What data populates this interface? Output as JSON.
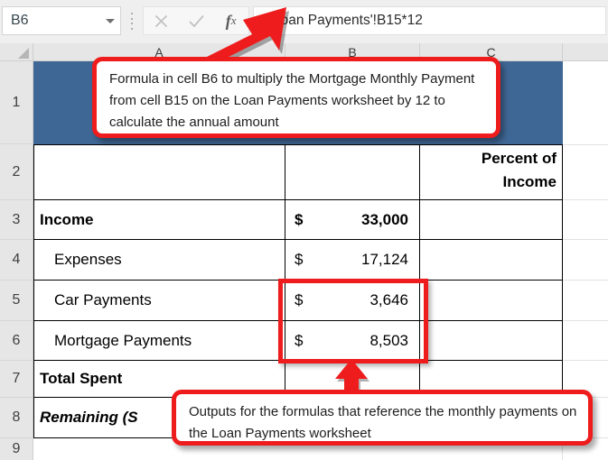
{
  "app": {
    "name": "Microsoft Excel",
    "colors": {
      "accent_red": "#ee1c1c",
      "row1_fill_blue": "#3f6795",
      "header_gray": "#e6e6e6",
      "toolbar_gray": "#efeff0"
    }
  },
  "formula_bar": {
    "name_box_value": "B6",
    "name_box_dropdown_icon": "chevron-down-icon",
    "grip_icon": "vertical-dots-grip-icon",
    "cancel_icon": "close-x-icon",
    "confirm_icon": "check-icon",
    "function_icon": "fx-insert-function-icon",
    "formula_value": "='Loan Payments'!B15*12",
    "formula_placeholder": ""
  },
  "sheet": {
    "column_headers": [
      "A",
      "B",
      "C"
    ],
    "row_headers": [
      "1",
      "2",
      "3",
      "4",
      "5",
      "6",
      "7",
      "8",
      "9"
    ],
    "select_all_icon": "select-all-corner-icon",
    "rows": [
      {
        "num": "1",
        "a": "",
        "b": "",
        "c": ""
      },
      {
        "num": "2",
        "a": "",
        "b": "",
        "c": "Percent of Income",
        "c_line1": "Percent of",
        "c_line2": "Income"
      },
      {
        "num": "3",
        "a": "Income",
        "b_symbol": "$",
        "b_value": "33,000",
        "c": ""
      },
      {
        "num": "4",
        "a": "Expenses",
        "b_symbol": "$",
        "b_value": "17,124",
        "c": ""
      },
      {
        "num": "5",
        "a": "Car Payments",
        "b_symbol": "$",
        "b_value": "3,646",
        "c": ""
      },
      {
        "num": "6",
        "a": "Mortgage Payments",
        "b_symbol": "$",
        "b_value": "8,503",
        "c": ""
      },
      {
        "num": "7",
        "a": "Total Spent",
        "b_symbol": "",
        "b_value": "",
        "c": ""
      },
      {
        "num": "8",
        "a": "Remaining (S",
        "b_symbol": "",
        "b_value": "",
        "c": ""
      },
      {
        "num": "9",
        "a": "",
        "b_symbol": "",
        "b_value": "",
        "c": ""
      }
    ]
  },
  "annotations": {
    "callout_top": "Formula in cell B6 to multiply the Mortgage Monthly Payment from cell B15 on the Loan Payments worksheet by 12 to calculate the annual amount",
    "callout_bottom": "Outputs for the formulas that reference the monthly payments on the Loan Payments worksheet",
    "arrow_to_formula_bar_icon": "red-arrow-up-right-icon",
    "arrow_to_cells_icon": "red-arrow-up-icon",
    "highlight_range_label": "B5:B6"
  }
}
